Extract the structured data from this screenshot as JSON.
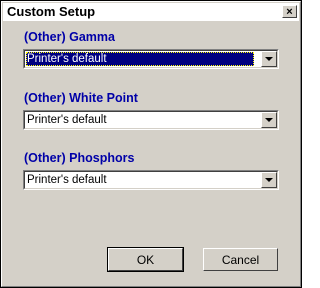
{
  "window": {
    "title": "Custom Setup",
    "close_glyph": "×"
  },
  "sections": [
    {
      "label": "(Other) Gamma",
      "value": "Printer's default"
    },
    {
      "label": "(Other) White Point",
      "value": "Printer's default"
    },
    {
      "label": "(Other) Phosphors",
      "value": "Printer's default"
    }
  ],
  "buttons": {
    "ok_label": "OK",
    "cancel_label": "Cancel"
  },
  "colors": {
    "section_label": "#0000a8",
    "selection": "#000080",
    "dialog_face": "#d4d0c8"
  }
}
